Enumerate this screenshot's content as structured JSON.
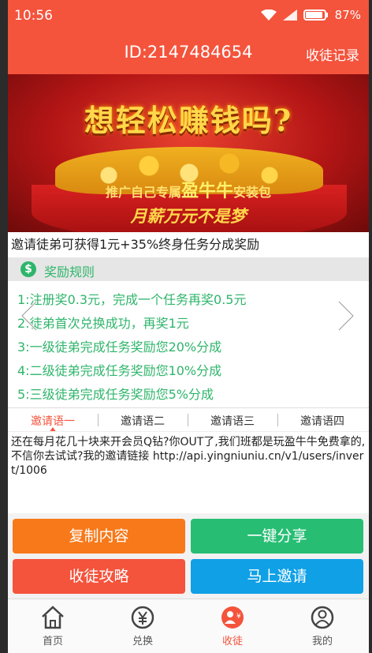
{
  "status": {
    "time": "10:56",
    "battery": "87%"
  },
  "header": {
    "title": "ID:2147484654",
    "action": "收徒记录"
  },
  "banner": {
    "headline": "想轻松赚钱吗?",
    "sub_prefix": "推广自己专属",
    "sub_brand": "盈牛牛",
    "sub_suffix": "安装包",
    "footer": "月薪万元不是梦"
  },
  "invite_line": "邀请徒弟可获得1元+35%终身任务分成奖励",
  "rules": {
    "title": "奖励规则",
    "items": [
      "1:注册奖0.3元，完成一个任务再奖0.5元",
      "2:徒弟首次兑换成功，再奖1元",
      "3:一级徒弟完成任务奖励您20%分成",
      "4:二级徒弟完成任务奖励您10%分成",
      "5:三级徒弟完成任务奖励您5%分成"
    ]
  },
  "tabs": [
    "邀请语一",
    "邀请语二",
    "邀请语三",
    "邀请语四"
  ],
  "invite_text": "还在每月花几十块来开会员Q钻?你OUT了,我们班都是玩盈牛牛免费拿的,不信你去试试?我的邀请链接  http://api.yingniuniu.cn/v1/users/invert/1006",
  "buttons": {
    "copy": "复制内容",
    "share": "一键分享",
    "guide": "收徒攻略",
    "invite": "马上邀请"
  },
  "tabbar": [
    "首页",
    "兑换",
    "收徒",
    "我的"
  ],
  "colors": {
    "primary": "#f4533c",
    "green": "#27be74",
    "orange": "#f7791a",
    "blue": "#10a0e6"
  }
}
